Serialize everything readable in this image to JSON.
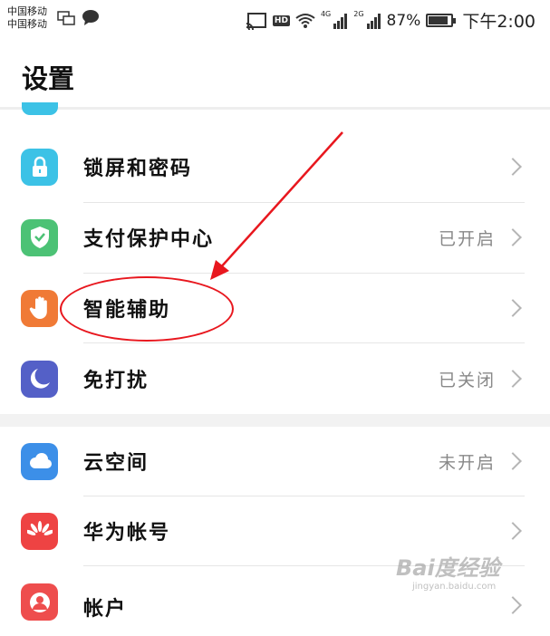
{
  "status_bar": {
    "carrier_1": "中国移动",
    "carrier_2": "中国移动",
    "hd": "HD",
    "sim1_type": "4G",
    "sim2_type": "2G",
    "battery_level": "87%",
    "battery_fraction": 0.87,
    "time": "下午2:00"
  },
  "header": {
    "title": "设置"
  },
  "settings": [
    {
      "label": "锁屏和密码",
      "status": "",
      "icon": "lock-icon",
      "color": "#3cc2e6"
    },
    {
      "label": "支付保护中心",
      "status": "已开启",
      "icon": "shield-check-icon",
      "color": "#4cc275"
    },
    {
      "label": "智能辅助",
      "status": "",
      "icon": "hand-icon",
      "color": "#f07a36"
    },
    {
      "label": "免打扰",
      "status": "已关闭",
      "icon": "moon-icon",
      "color": "#5460c7"
    },
    {
      "label": "云空间",
      "status": "未开启",
      "icon": "cloud-icon",
      "color": "#3c8fe8"
    },
    {
      "label": "华为帐号",
      "status": "",
      "icon": "huawei-logo-icon",
      "color": "#ee4343"
    },
    {
      "label": "帐户",
      "status": "",
      "icon": "person-icon",
      "color": "#ee4d4d"
    }
  ],
  "watermark": {
    "main": "Bai度经验",
    "sub": "jingyan.baidu.com"
  }
}
